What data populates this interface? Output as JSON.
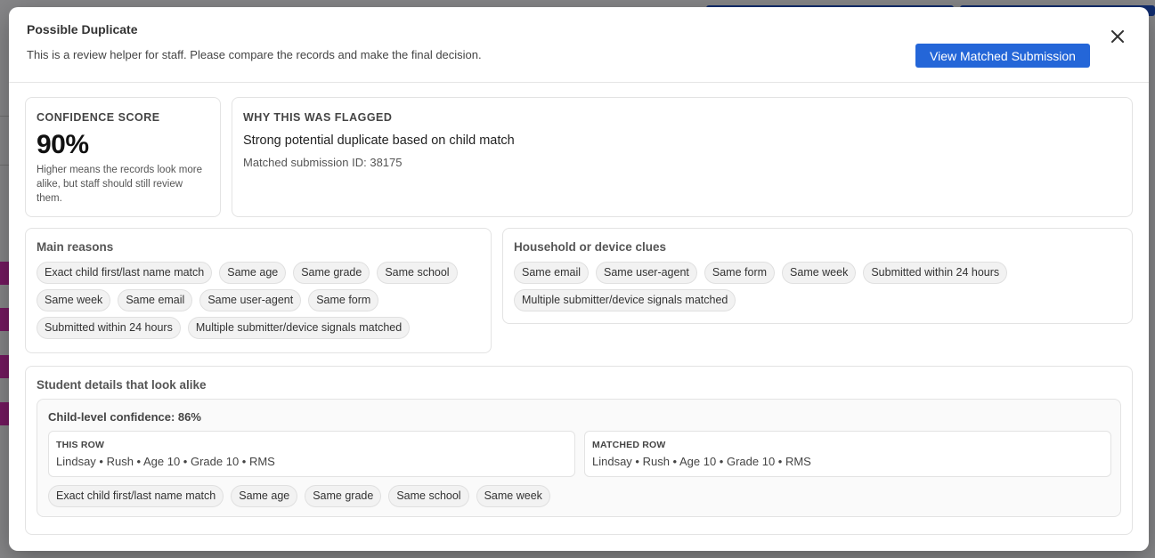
{
  "modal": {
    "title": "Possible Duplicate",
    "subtitle": "This is a review helper for staff. Please compare the records and make the final decision.",
    "view_button": "View Matched Submission"
  },
  "confidence": {
    "label": "CONFIDENCE SCORE",
    "score": "90%",
    "help": "Higher means the records look more alike, but staff should still review them."
  },
  "flagged": {
    "label": "WHY THIS WAS FLAGGED",
    "reason": "Strong potential duplicate based on child match",
    "matched_id": "Matched submission ID: 38175"
  },
  "main_reasons": {
    "title": "Main reasons",
    "chips": [
      "Exact child first/last name match",
      "Same age",
      "Same grade",
      "Same school",
      "Same week",
      "Same email",
      "Same user-agent",
      "Same form",
      "Submitted within 24 hours",
      "Multiple submitter/device signals matched"
    ]
  },
  "household": {
    "title": "Household or device clues",
    "chips": [
      "Same email",
      "Same user-agent",
      "Same form",
      "Same week",
      "Submitted within 24 hours",
      "Multiple submitter/device signals matched"
    ]
  },
  "student": {
    "title": "Student details that look alike",
    "child_confidence": "Child-level confidence: 86%",
    "this_row_label": "THIS ROW",
    "this_row_value": "Lindsay • Rush • Age 10 • Grade 10 • RMS",
    "matched_row_label": "MATCHED ROW",
    "matched_row_value": "Lindsay • Rush • Age 10 • Grade 10 • RMS",
    "chips": [
      "Exact child first/last name match",
      "Same age",
      "Same grade",
      "Same school",
      "Same week"
    ]
  },
  "colors": {
    "accent": "#2466d8",
    "overlay": "rgba(0,0,0,0.45)"
  },
  "icons": {
    "close": "close-icon"
  }
}
